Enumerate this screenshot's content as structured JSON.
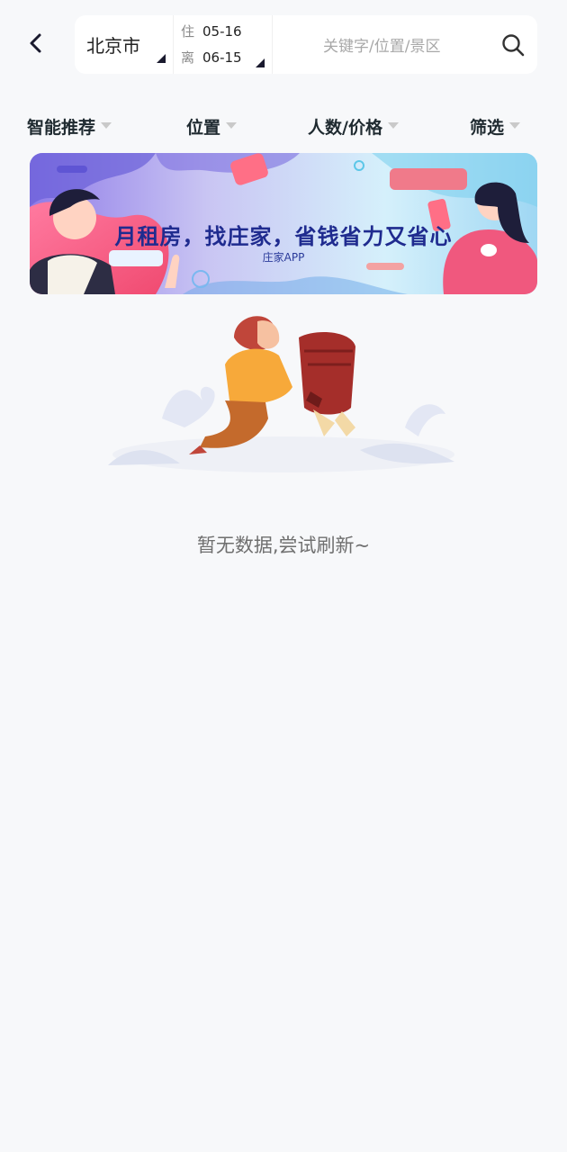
{
  "header": {
    "city": "北京市",
    "checkin_label": "住",
    "checkin_date": "05-16",
    "checkout_label": "离",
    "checkout_date": "06-15",
    "search_placeholder": "关键字/位置/景区"
  },
  "filters": [
    {
      "label": "智能推荐"
    },
    {
      "label": "位置"
    },
    {
      "label": "人数/价格"
    },
    {
      "label": "筛选"
    }
  ],
  "banner": {
    "headline": "月租房，找庄家，省钱省力又省心",
    "sub": "庄家APP"
  },
  "empty_state": {
    "message": "暂无数据,尝试刷新~"
  },
  "colors": {
    "background": "#f7f8fa",
    "card": "#ffffff",
    "banner_text": "#1f2b8f",
    "placeholder": "#a8a8a8"
  },
  "icons": [
    "back-arrow-icon",
    "dropdown-corner-icon",
    "search-icon",
    "dropdown-arrow-icon"
  ]
}
